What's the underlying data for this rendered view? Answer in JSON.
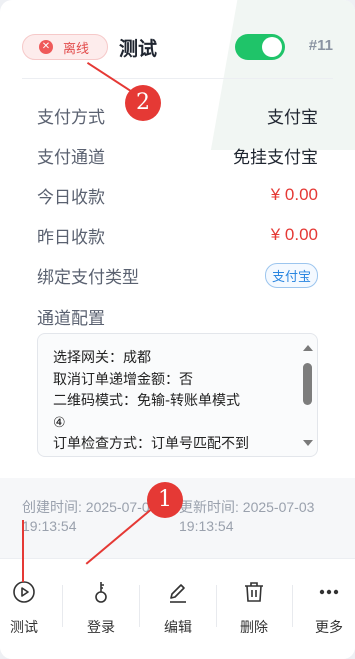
{
  "header": {
    "status_label": "离线",
    "title": "测试",
    "toggle_on": true,
    "number": "#11"
  },
  "info": {
    "pay_method_label": "支付方式",
    "pay_method_value": "支付宝",
    "pay_channel_label": "支付通道",
    "pay_channel_value": "免挂支付宝",
    "today_label": "今日收款",
    "today_value": "¥ 0.00",
    "yesterday_label": "昨日收款",
    "yesterday_value": "¥ 0.00",
    "bind_type_label": "绑定支付类型",
    "bind_type_tag": "支付宝"
  },
  "config": {
    "label": "通道配置",
    "lines": [
      "选择网关：成都",
      "取消订单递增金额：否",
      "二维码模式：免输-转账单模式",
      "④",
      "订单检查方式：订单号匹配不到"
    ]
  },
  "footer": {
    "created": "创建时间: 2025-07-03 19:13:54",
    "updated": "更新时间: 2025-07-03 19:13:54"
  },
  "toolbar": {
    "items": [
      {
        "label": "测试",
        "icon": "play-circle-icon"
      },
      {
        "label": "登录",
        "icon": "key-icon"
      },
      {
        "label": "编辑",
        "icon": "edit-pen-icon"
      },
      {
        "label": "删除",
        "icon": "trash-icon"
      },
      {
        "label": "更多",
        "icon": "more-dots-icon"
      }
    ]
  },
  "annotations": {
    "marker_1": "1",
    "marker_2": "2"
  },
  "colors": {
    "accent_green": "#1fc469",
    "offline_red": "#e24c4c",
    "money_red": "#e53935",
    "tag_blue": "#2a86e0",
    "annotation_red": "#e53935"
  }
}
